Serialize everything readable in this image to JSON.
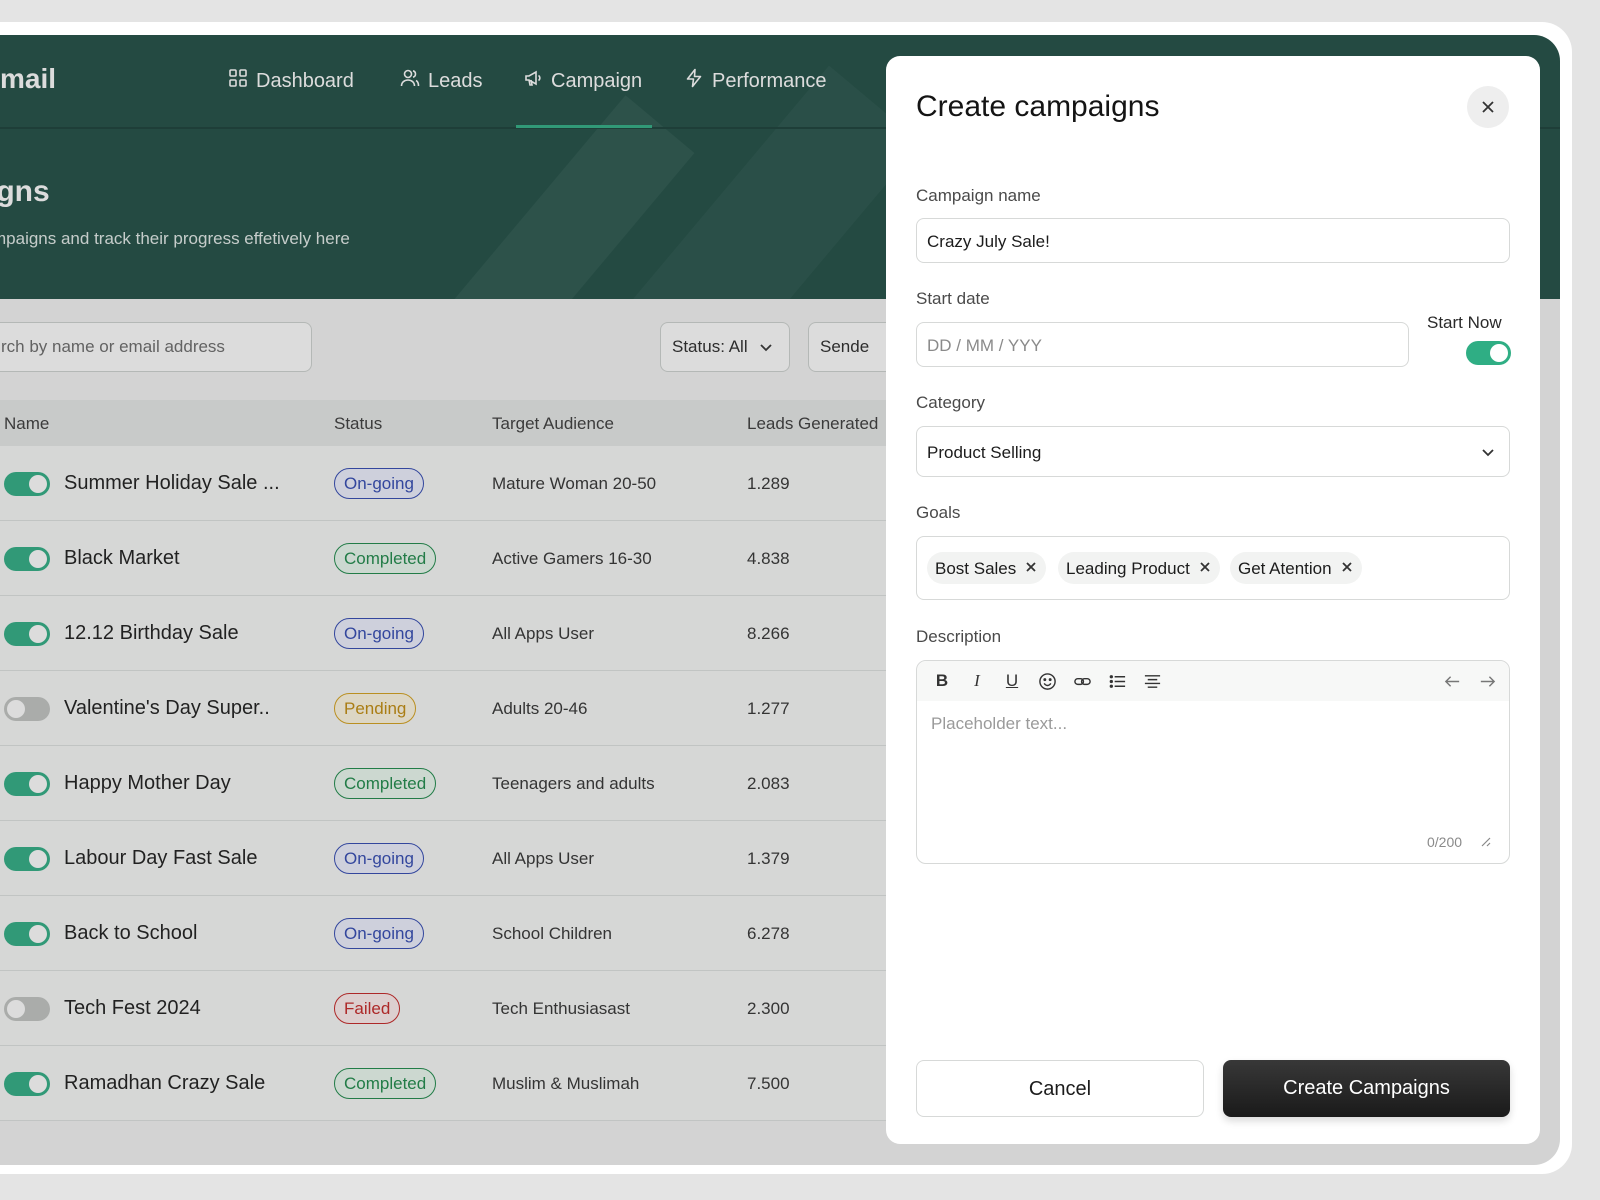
{
  "app": {
    "logo": "mail"
  },
  "nav": {
    "items": [
      {
        "label": "Dashboard",
        "icon": "grid-icon"
      },
      {
        "label": "Leads",
        "icon": "users-icon"
      },
      {
        "label": "Campaign",
        "icon": "megaphone-icon",
        "active": true
      },
      {
        "label": "Performance",
        "icon": "lightning-icon"
      }
    ]
  },
  "page": {
    "title": "igns",
    "subtitle": "mpaigns and track their progress effetively here"
  },
  "filters": {
    "search_placeholder": "rch by name or email address",
    "status_label": "Status: All",
    "sender_label": "Sende"
  },
  "table": {
    "headers": {
      "name": "Name",
      "status": "Status",
      "audience": "Target Audience",
      "leads": "Leads Generated"
    },
    "rows": [
      {
        "name": "Summer Holiday Sale ...",
        "status": "On-going",
        "audience": "Mature Woman 20-50",
        "leads": "1.289"
      },
      {
        "name": "Black Market",
        "status": "Completed",
        "audience": "Active Gamers 16-30",
        "leads": "4.838"
      },
      {
        "name": "12.12 Birthday Sale",
        "status": "On-going",
        "audience": "All Apps User",
        "leads": "8.266"
      },
      {
        "name": "Valentine's Day Super..",
        "status": "Pending",
        "audience": "Adults 20-46",
        "leads": "1.277"
      },
      {
        "name": "Happy Mother Day",
        "status": "Completed",
        "audience": "Teenagers and adults",
        "leads": "2.083"
      },
      {
        "name": "Labour Day Fast Sale",
        "status": "On-going",
        "audience": "All Apps User",
        "leads": "1.379"
      },
      {
        "name": "Back to School",
        "status": "On-going",
        "audience": "School Children",
        "leads": "6.278"
      },
      {
        "name": "Tech Fest 2024",
        "status": "Failed",
        "audience": "Tech Enthusiasast",
        "leads": "2.300"
      },
      {
        "name": "Ramadhan Crazy Sale",
        "status": "Completed",
        "audience": "Muslim & Muslimah",
        "leads": "7.500"
      }
    ]
  },
  "modal": {
    "title": "Create campaigns",
    "campaign_name_label": "Campaign name",
    "campaign_name_value": "Crazy July Sale!",
    "start_date_label": "Start date",
    "start_date_placeholder": "DD / MM / YYY",
    "start_now_label": "Start Now",
    "category_label": "Category",
    "category_value": "Product Selling",
    "goals_label": "Goals",
    "goals": [
      "Bost Sales",
      "Leading Product",
      "Get Atention"
    ],
    "description_label": "Description",
    "description_placeholder": "Placeholder text...",
    "char_count": "0/200",
    "cancel_label": "Cancel",
    "create_label": "Create Campaigns"
  },
  "colors": {
    "primary": "#1f4e44",
    "accent": "#2fae84",
    "button_dark": "#222222"
  }
}
